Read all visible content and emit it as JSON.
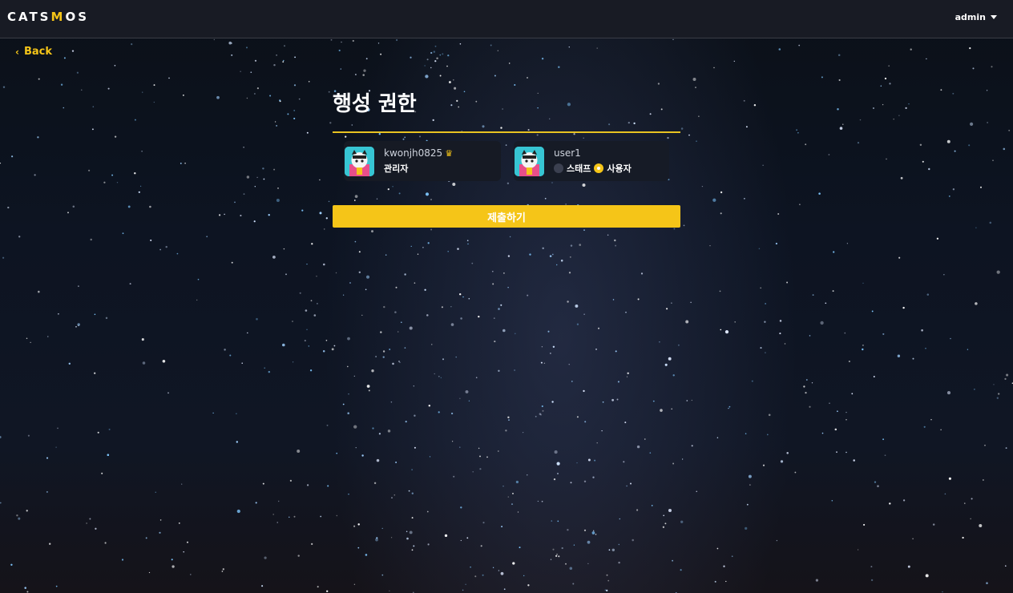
{
  "header": {
    "logo_parts": [
      "CATS",
      "M",
      "OS"
    ],
    "user_label": "admin"
  },
  "nav": {
    "back_label": "Back"
  },
  "page": {
    "title": "행성 권한"
  },
  "members": [
    {
      "username": "kwonjh0825",
      "role_label": "관리자",
      "has_crown": true
    },
    {
      "username": "user1",
      "role_options": [
        "스태프",
        "사용자"
      ],
      "selected_role": "사용자"
    }
  ],
  "actions": {
    "submit_label": "제출하기"
  },
  "colors": {
    "accent": "#f5c518",
    "topbar": "#181b24",
    "card": "#161a24"
  }
}
